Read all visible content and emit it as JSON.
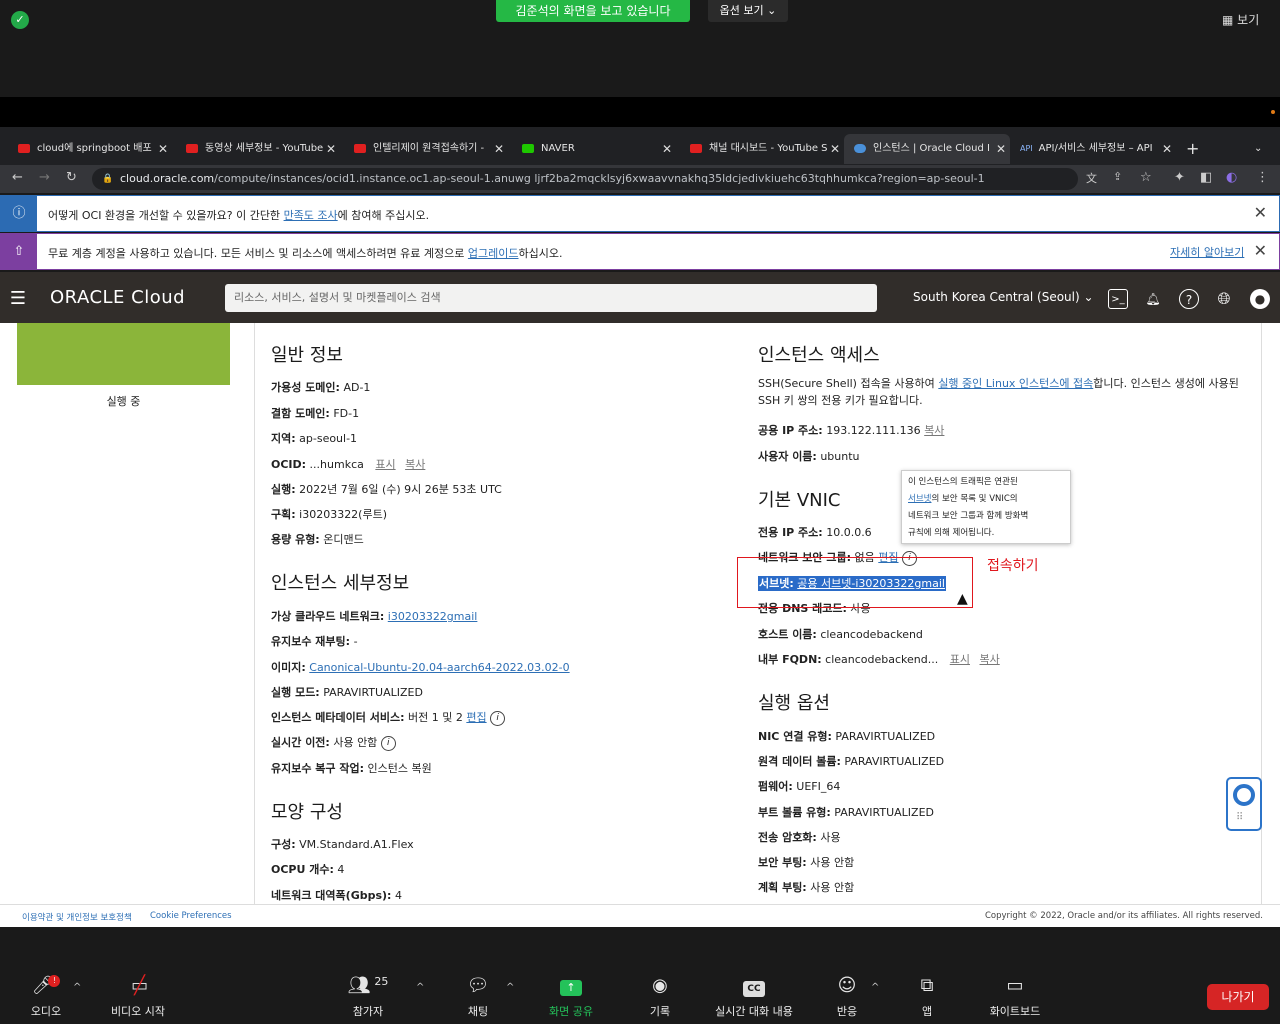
{
  "zoom": {
    "share_status": "김준석의 화면을 보고 있습니다",
    "options_label": "옵션 보기 ⌄",
    "view_label": "보기",
    "toolbar": [
      {
        "label": "오디오",
        "icon": "mic-icon"
      },
      {
        "label": "비디오 시작",
        "icon": "video-off-icon"
      },
      {
        "label": "참가자",
        "icon": "participants-icon",
        "count": "25"
      },
      {
        "label": "채팅",
        "icon": "chat-icon"
      },
      {
        "label": "화면 공유",
        "icon": "share-screen-icon"
      },
      {
        "label": "기록",
        "icon": "record-icon"
      },
      {
        "label": "실시간 대화 내용",
        "icon": "cc-icon"
      },
      {
        "label": "반응",
        "icon": "reaction-icon"
      },
      {
        "label": "앱",
        "icon": "apps-icon"
      },
      {
        "label": "화이트보드",
        "icon": "whiteboard-icon"
      }
    ],
    "leave_label": "나가기"
  },
  "browser": {
    "tabs": [
      {
        "title": "cloud에 springboot 배포"
      },
      {
        "title": "동영상 세부정보 - YouTube"
      },
      {
        "title": "인텔리제이 원격접속하기 - "
      },
      {
        "title": "NAVER"
      },
      {
        "title": "채널 대시보드 - YouTube S"
      },
      {
        "title": "인스턴스 | Oracle Cloud I"
      },
      {
        "title": "API/서비스 세부정보 – API"
      }
    ],
    "url_host": "cloud.oracle.com",
    "url_path": "/compute/instances/ocid1.instance.oc1.ap-seoul-1.anuwg ljrf2ba2mqcklsyj6xwaavvnakhq35ldcjedivkiuehc63tqhhumkca?region=ap-seoul-1"
  },
  "banners": {
    "survey_text_a": "어떻게 OCI 환경을 개선할 수 있을까요? 이 간단한 ",
    "survey_link": "만족도 조사",
    "survey_text_b": "에 참여해 주십시오.",
    "tier_text_a": "무료 계층 계정을 사용하고 있습니다. 모든 서비스 및 리소스에 액세스하려면 유료 계정으로 ",
    "tier_link": "업그레이드",
    "tier_text_b": "하십시오.",
    "learn_more": "자세히 알아보기"
  },
  "oci": {
    "logo": "ORACLE Cloud",
    "search_placeholder": "리소스, 서비스, 설명서 및 마켓플레이스 검색",
    "region": "South Korea Central (Seoul)"
  },
  "left": {
    "status": "실행 중"
  },
  "general": {
    "title": "일반 정보",
    "rows": [
      {
        "k": "가용성 도메인:",
        "v": "AD-1"
      },
      {
        "k": "결함 도메인:",
        "v": "FD-1"
      },
      {
        "k": "지역:",
        "v": "ap-seoul-1"
      },
      {
        "k": "OCID:",
        "v": "...humkca"
      },
      {
        "k": "실행:",
        "v": "2022년 7월 6일 (수) 9시 26분 53초 UTC"
      },
      {
        "k": "구획:",
        "v": "i30203322(루트)"
      },
      {
        "k": "용량 유형:",
        "v": "온디맨드"
      }
    ],
    "show": "표시",
    "copy": "복사"
  },
  "details": {
    "title": "인스턴스 세부정보",
    "rows": [
      {
        "k": "가상 클라우드 네트워크:",
        "v": "i30203322gmail"
      },
      {
        "k": "유지보수 재부팅:",
        "v": "-"
      },
      {
        "k": "이미지:",
        "v": "Canonical-Ubuntu-20.04-aarch64-2022.03.02-0"
      },
      {
        "k": "실행 모드:",
        "v": "PARAVIRTUALIZED"
      },
      {
        "k": "인스턴스 메타데이터 서비스:",
        "v": "버전 1 및 2"
      },
      {
        "k": "실시간 이전:",
        "v": "사용 안함"
      },
      {
        "k": "유지보수 복구 작업:",
        "v": "인스턴스 복원"
      }
    ],
    "edit": "편집"
  },
  "shape": {
    "title": "모양 구성",
    "rows": [
      {
        "k": "구성:",
        "v": "VM.Standard.A1.Flex"
      },
      {
        "k": "OCPU 개수:",
        "v": "4"
      },
      {
        "k": "네트워크 대역폭(Gbps):",
        "v": "4"
      }
    ]
  },
  "access": {
    "title": "인스턴스 액세스",
    "desc_a": "SSH(Secure Shell) 접속을 사용하여 ",
    "desc_link": "실행 중인 Linux 인스턴스에 접속",
    "desc_b": "합니다. 인스턴스 생성에 사용된",
    "desc_c": "SSH 키 쌍의 전용 키가 필요합니다.",
    "ip_k": "공용 IP 주소:",
    "ip_v": "193.122.111.136",
    "copy": "복사",
    "user_k": "사용자 이름:",
    "user_v": "ubuntu"
  },
  "vnic": {
    "title": "기본 VNIC",
    "private_ip_k": "전용 IP 주소:",
    "private_ip_v": "10.0.0.6",
    "nsg_k": "네트워크 보안 그룹:",
    "nsg_v": "없음",
    "edit": "편집",
    "subnet_k": "서브넷:",
    "subnet_v": "공용 서브넷-i30203322gmail",
    "dns_k": "전용 DNS 레코드:",
    "dns_v": "사용",
    "host_k": "호스트 이름:",
    "host_v": "cleancodebackend",
    "fqdn_k": "내부 FQDN:",
    "fqdn_v": "cleancodebackend...",
    "show": "표시",
    "copy": "복사",
    "tooltip_1": "이 인스턴스의 트래픽은 연관된",
    "tooltip_link": "서브넷",
    "tooltip_2": "의 보안 목록 및 VNIC의",
    "tooltip_3": "네트워크 보안 그룹과 함께 방화벽",
    "tooltip_4": "규칙에 의해 제어됩니다.",
    "annotation": "접속하기"
  },
  "launch": {
    "title": "실행 옵션",
    "rows": [
      {
        "k": "NIC 연결 유형:",
        "v": "PARAVIRTUALIZED"
      },
      {
        "k": "원격 데이터 볼륨:",
        "v": "PARAVIRTUALIZED"
      },
      {
        "k": "펌웨어:",
        "v": "UEFI_64"
      },
      {
        "k": "부트 볼륨 유형:",
        "v": "PARAVIRTUALIZED"
      },
      {
        "k": "전송 암호화:",
        "v": "사용"
      },
      {
        "k": "보안 부팅:",
        "v": "사용 안함"
      },
      {
        "k": "계획 부팅:",
        "v": "사용 안함"
      }
    ]
  },
  "footer": {
    "terms": "이용약관 및 개인정보 보호정책",
    "cookie": "Cookie Preferences",
    "copyright": "Copyright © 2022, Oracle and/or its affiliates. All rights reserved."
  }
}
